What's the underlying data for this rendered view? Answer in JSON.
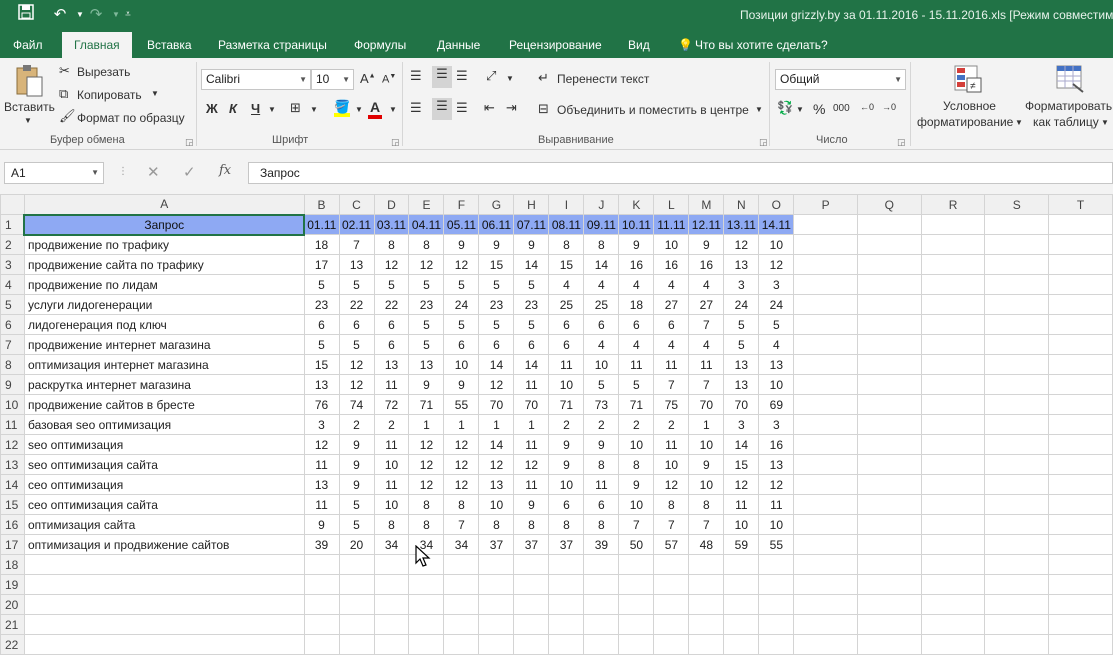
{
  "window": {
    "title": "Позиции grizzly.by за 01.11.2016 - 15.11.2016.xls  [Режим совместимо"
  },
  "tabs": [
    "Файл",
    "Главная",
    "Вставка",
    "Разметка страницы",
    "Формулы",
    "Данные",
    "Рецензирование",
    "Вид"
  ],
  "tell_me": "Что вы хотите сделать?",
  "clipboard": {
    "paste": "Вставить",
    "cut": "Вырезать",
    "copy": "Копировать",
    "format_painter": "Формат по образцу",
    "label": "Буфер обмена"
  },
  "font": {
    "name": "Calibri",
    "size": "10",
    "bold": "Ж",
    "italic": "К",
    "underline": "Ч",
    "label": "Шрифт"
  },
  "alignment": {
    "wrap": "Перенести текст",
    "merge": "Объединить и поместить в центре",
    "label": "Выравнивание"
  },
  "number": {
    "format": "Общий",
    "percent": "%",
    "comma": "000",
    "label": "Число"
  },
  "styles": {
    "conditional_1": "Условное",
    "conditional_2": "форматирование",
    "table_1": "Форматировать",
    "table_2": "как таблицу"
  },
  "formula_bar": {
    "name_box": "A1",
    "content": "Запрос"
  },
  "sheet": {
    "columns": [
      "A",
      "B",
      "C",
      "D",
      "E",
      "F",
      "G",
      "H",
      "I",
      "J",
      "K",
      "L",
      "M",
      "N",
      "O",
      "P",
      "Q",
      "R",
      "S",
      "T"
    ],
    "header_row": [
      "Запрос",
      "01.11",
      "02.11",
      "03.11",
      "04.11",
      "05.11",
      "06.11",
      "07.11",
      "08.11",
      "09.11",
      "10.11",
      "11.11",
      "12.11",
      "13.11",
      "14.11"
    ],
    "rows": [
      [
        "продвижение по трафику",
        "18",
        "7",
        "8",
        "8",
        "9",
        "9",
        "9",
        "8",
        "8",
        "9",
        "10",
        "9",
        "12",
        "10"
      ],
      [
        "продвижение сайта по трафику",
        "17",
        "13",
        "12",
        "12",
        "12",
        "15",
        "14",
        "15",
        "14",
        "16",
        "16",
        "16",
        "13",
        "12"
      ],
      [
        "продвижение по лидам",
        "5",
        "5",
        "5",
        "5",
        "5",
        "5",
        "5",
        "4",
        "4",
        "4",
        "4",
        "4",
        "3",
        "3"
      ],
      [
        "услуги лидогенерации",
        "23",
        "22",
        "22",
        "23",
        "24",
        "23",
        "23",
        "25",
        "25",
        "18",
        "27",
        "27",
        "24",
        "24"
      ],
      [
        "лидогенерация под ключ",
        "6",
        "6",
        "6",
        "5",
        "5",
        "5",
        "5",
        "6",
        "6",
        "6",
        "6",
        "7",
        "5",
        "5"
      ],
      [
        "продвижение интернет магазина",
        "5",
        "5",
        "6",
        "5",
        "6",
        "6",
        "6",
        "6",
        "4",
        "4",
        "4",
        "4",
        "5",
        "4"
      ],
      [
        "оптимизация интернет магазина",
        "15",
        "12",
        "13",
        "13",
        "10",
        "14",
        "14",
        "11",
        "10",
        "11",
        "11",
        "11",
        "13",
        "13"
      ],
      [
        "раскрутка интернет магазина",
        "13",
        "12",
        "11",
        "9",
        "9",
        "12",
        "11",
        "10",
        "5",
        "5",
        "7",
        "7",
        "13",
        "10"
      ],
      [
        "продвижение сайтов в бресте",
        "76",
        "74",
        "72",
        "71",
        "55",
        "70",
        "70",
        "71",
        "73",
        "71",
        "75",
        "70",
        "70",
        "69"
      ],
      [
        "базовая seo оптимизация",
        "3",
        "2",
        "2",
        "1",
        "1",
        "1",
        "1",
        "2",
        "2",
        "2",
        "2",
        "1",
        "3",
        "3"
      ],
      [
        "seo оптимизация",
        "12",
        "9",
        "11",
        "12",
        "12",
        "14",
        "11",
        "9",
        "9",
        "10",
        "11",
        "10",
        "14",
        "16"
      ],
      [
        "seo оптимизация сайта",
        "11",
        "9",
        "10",
        "12",
        "12",
        "12",
        "12",
        "9",
        "8",
        "8",
        "10",
        "9",
        "15",
        "13"
      ],
      [
        "сео оптимизация",
        "13",
        "9",
        "11",
        "12",
        "12",
        "13",
        "11",
        "10",
        "11",
        "9",
        "12",
        "10",
        "12",
        "12"
      ],
      [
        "сео оптимизация сайта",
        "11",
        "5",
        "10",
        "8",
        "8",
        "10",
        "9",
        "6",
        "6",
        "10",
        "8",
        "8",
        "11",
        "11"
      ],
      [
        "оптимизация сайта",
        "9",
        "5",
        "8",
        "8",
        "7",
        "8",
        "8",
        "8",
        "8",
        "7",
        "7",
        "7",
        "10",
        "10"
      ],
      [
        "оптимизация и продвижение сайтов",
        "39",
        "20",
        "34",
        "34",
        "34",
        "37",
        "37",
        "37",
        "39",
        "50",
        "57",
        "48",
        "59",
        "55"
      ]
    ],
    "empty_row_numbers": [
      18,
      19,
      20,
      21,
      22
    ]
  }
}
